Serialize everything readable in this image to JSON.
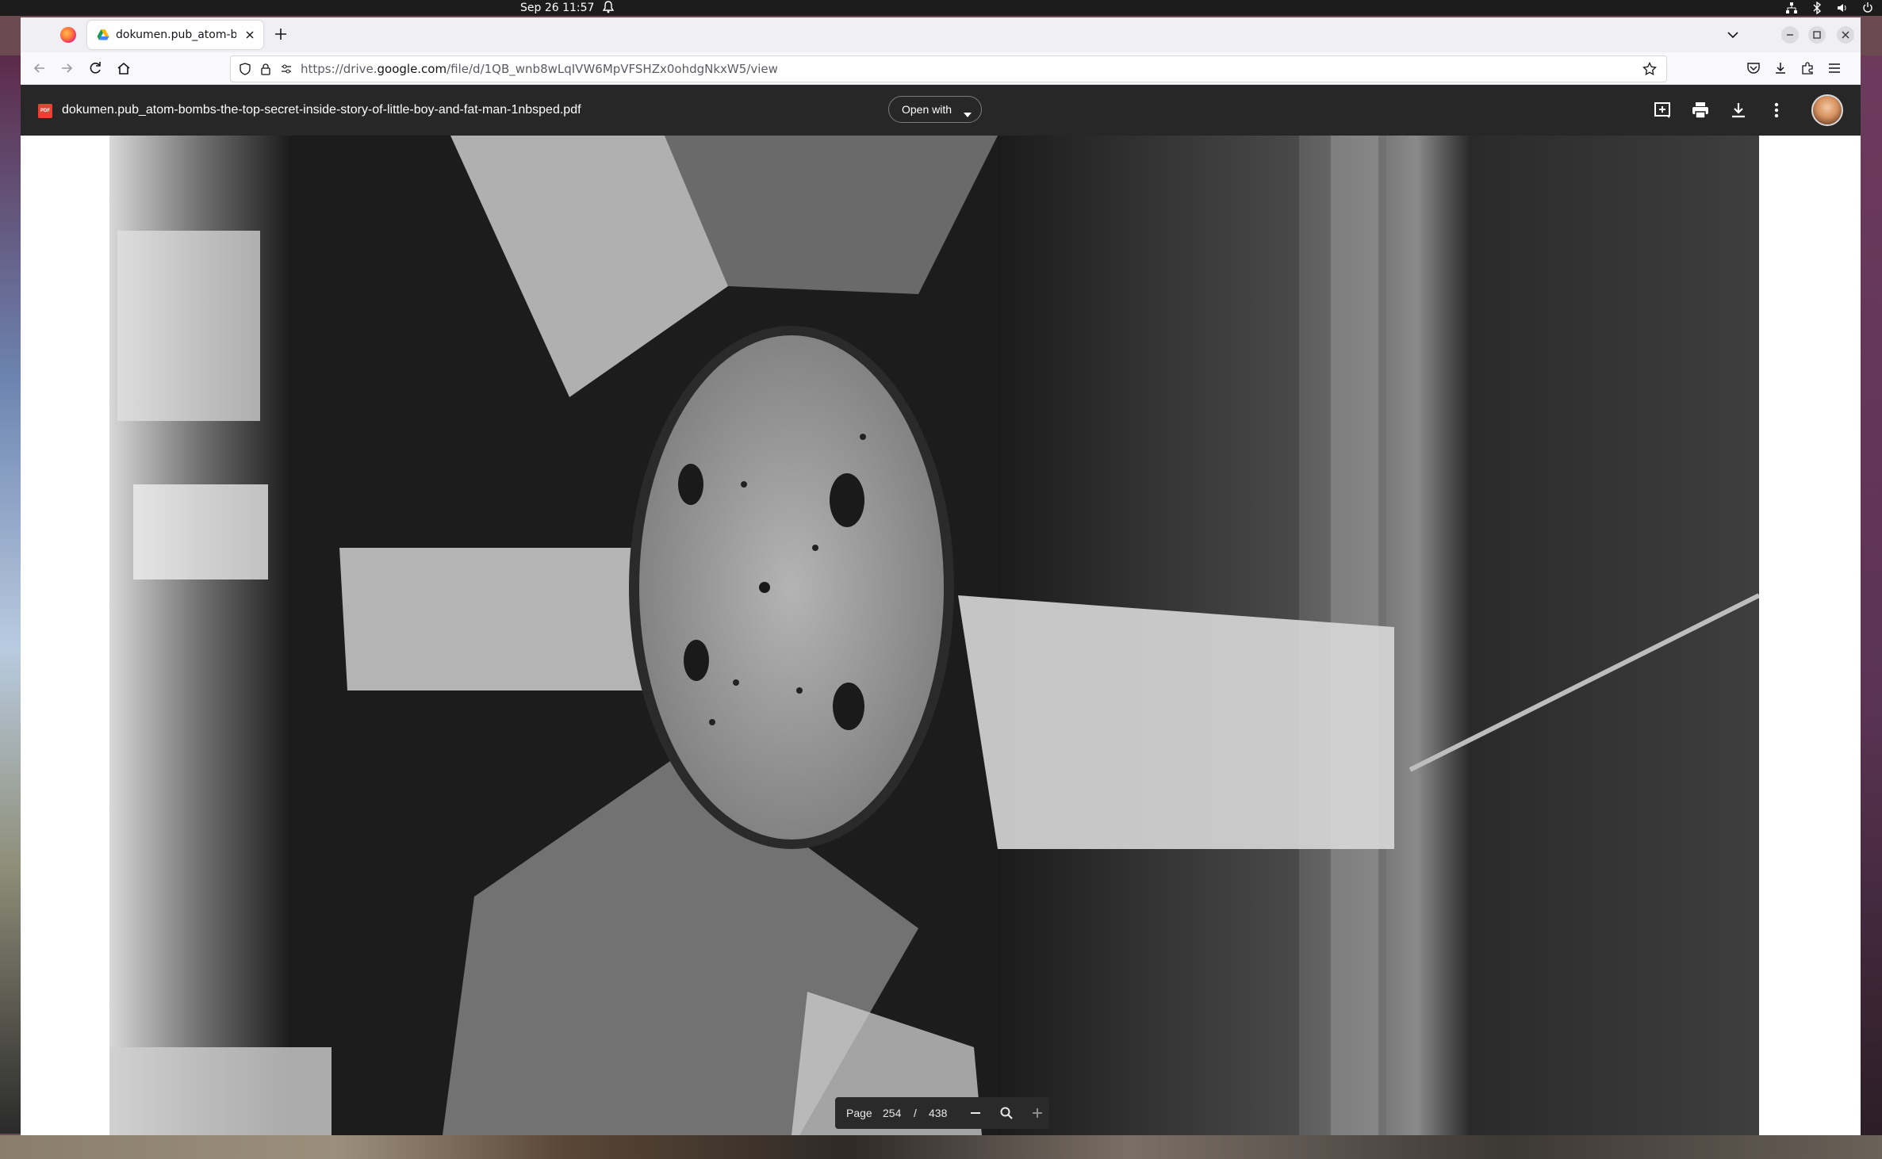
{
  "system": {
    "clock": "Sep 26  11:57"
  },
  "browser": {
    "tab_title": "dokumen.pub_atom-bom",
    "url_prefix": "https://drive.",
    "url_domain": "google.com",
    "url_rest": "/file/d/1QB_wnb8wLqIVW6MpVFSHZx0ohdgNkxW5/view"
  },
  "viewer": {
    "file_type_badge": "PDF",
    "file_name": "dokumen.pub_atom-bombs-the-top-secret-inside-story-of-little-boy-and-fat-man-1nbsped.pdf",
    "open_with_label": "Open with",
    "page_label": "Page",
    "current_page": "254",
    "separator": "/",
    "total_pages": "438"
  },
  "icons": {
    "tab_favicon": "google-drive-icon",
    "add_comment": "add-comment-icon",
    "print": "print-icon",
    "download": "download-icon",
    "more": "more-vert-icon",
    "zoom_out": "minus-icon",
    "zoom": "magnifier-icon",
    "zoom_in": "plus-icon"
  },
  "colors": {
    "viewer_header": "#1e1e1e",
    "pdf_badge": "#e94235",
    "page_controls_bg": "#2a2a2a"
  }
}
